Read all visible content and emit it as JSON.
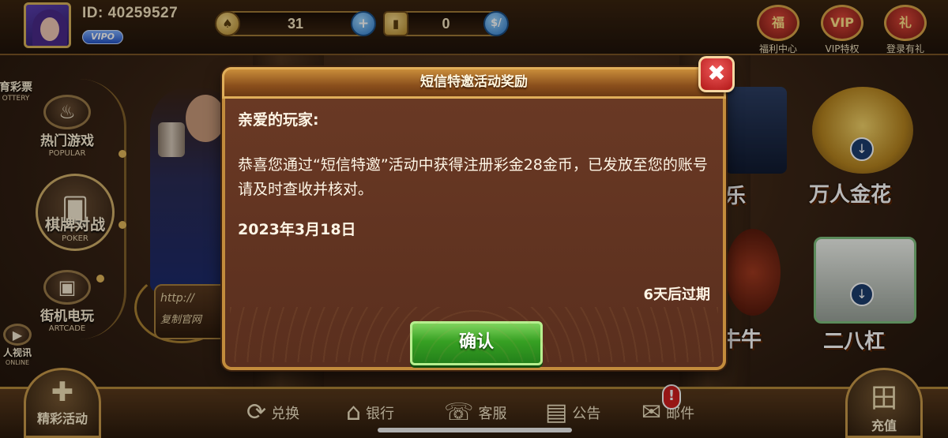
{
  "topbar": {
    "user_id": "ID: 40259527",
    "vip_label": "VIPO",
    "gold": "31",
    "gold_add": "+",
    "diamonds": "0",
    "diamond_exchange": "$/",
    "icons": [
      {
        "label": "福利中心",
        "icon": "gift-bag-icon"
      },
      {
        "label": "VIP特权",
        "icon": "vip-crown-icon"
      },
      {
        "label": "登录有礼",
        "icon": "gift-box-icon"
      }
    ]
  },
  "left_menu": [
    {
      "cn": "育彩票",
      "en": "OTTERY",
      "icon": "lottery-ticket-icon"
    },
    {
      "cn": "热门游戏",
      "en": "POPULAR",
      "icon": "flame-icon"
    },
    {
      "cn": "棋牌对战",
      "en": "POKER",
      "icon": "playing-cards-icon"
    },
    {
      "cn": "街机电玩",
      "en": "ARTCADE",
      "icon": "arcade-icon"
    },
    {
      "cn": "人视讯",
      "en": "ONLINE",
      "icon": "video-camera-icon"
    }
  ],
  "background": {
    "url_line1": "http://",
    "url_line2": "复制官网"
  },
  "right_tiles": {
    "tile1_partial": "乐",
    "tile2": "万人金花",
    "tile3_partial": "牛牛",
    "tile4": "二八杠"
  },
  "dialog": {
    "title": "短信特邀活动奖励",
    "greeting": "亲爱的玩家:",
    "message": "恭喜您通过“短信特邀”活动中获得注册彩金28金币，已发放至您的账号请及时查收并核对。",
    "date": "2023年3月18日",
    "expire": "6天后过期",
    "confirm": "确认",
    "close": "✖"
  },
  "bottom_nav": [
    {
      "label": "兑换",
      "icon": "exchange-icon"
    },
    {
      "label": "银行",
      "icon": "bank-icon"
    },
    {
      "label": "客服",
      "icon": "customer-service-icon"
    },
    {
      "label": "公告",
      "icon": "notice-icon"
    },
    {
      "label": "邮件",
      "icon": "mail-icon",
      "alert": "!"
    }
  ],
  "bottom_buttons": {
    "left": "精彩活动",
    "right": "充值"
  }
}
